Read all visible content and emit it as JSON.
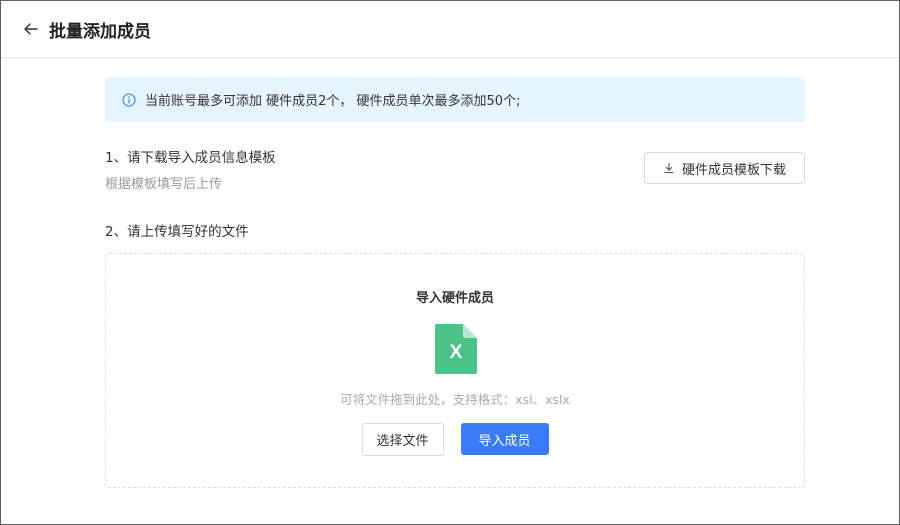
{
  "header": {
    "title": "批量添加成员",
    "back_icon": "arrow-left-icon"
  },
  "notice": {
    "icon": "info-circle-icon",
    "text": "当前账号最多可添加 硬件成员2个， 硬件成员单次最多添加50个;",
    "background": "#e6f4fd",
    "icon_color": "#3a7bf6"
  },
  "step1": {
    "title": "1、请下载导入成员信息模板",
    "subtitle": "根据模板填写后上传",
    "download_label": "硬件成员模板下载",
    "download_icon": "download-icon"
  },
  "step2": {
    "title": "2、请上传填写好的文件"
  },
  "upload": {
    "title": "导入硬件成员",
    "file_icon": "excel-file-icon",
    "file_letter": "X",
    "file_color": "#4cc38a",
    "hint": "可将文件拖到此处，支持格式：xsl、xslx",
    "choose_label": "选择文件",
    "import_label": "导入成员",
    "primary_color": "#3a7bf6"
  }
}
